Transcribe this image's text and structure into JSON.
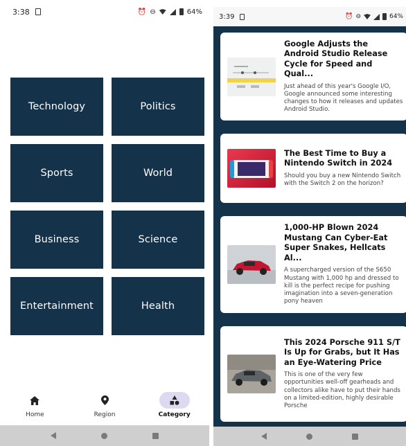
{
  "left": {
    "status": {
      "time": "3:38",
      "battery": "64%",
      "net": "Volte LTE"
    },
    "categories": [
      "Technology",
      "Politics",
      "Sports",
      "World",
      "Business",
      "Science",
      "Entertainment",
      "Health"
    ],
    "nav": [
      {
        "label": "Home",
        "icon": "home-icon"
      },
      {
        "label": "Region",
        "icon": "location-pin-icon"
      },
      {
        "label": "Category",
        "icon": "category-icon",
        "active": true
      }
    ]
  },
  "right": {
    "status": {
      "time": "3:39",
      "battery": "64%"
    },
    "articles": [
      {
        "title": "Google Adjusts the Android Studio Release Cycle for Speed and Qual...",
        "desc": "Just ahead of this year's Google I/O, Google announced some interesting changes to how it releases and updates Android Studio."
      },
      {
        "title": "The Best Time to Buy a Nintendo Switch in 2024",
        "desc": "Should you buy a new Nintendo Switch with the Switch 2 on the horizon?"
      },
      {
        "title": "1,000-HP Blown 2024 Mustang Can Cyber-Eat Super Snakes, Hellcats Al...",
        "desc": "A supercharged version of the S650 Mustang with 1,000 hp and dressed to kill is the perfect recipe for pushing imagination into a seven-generation pony heaven"
      },
      {
        "title": "This 2024 Porsche 911 S/T Is Up for Grabs, but It Has an Eye-Watering Price",
        "desc": "This is one of the very few opportunities well-off gearheads and collectors alike have to put their hands on a limited-edition, highly desirable Porsche"
      }
    ]
  },
  "colors": {
    "tile": "#14324a",
    "nav_active": "#dcdaf0",
    "sysbar": "#cfcfcf"
  }
}
